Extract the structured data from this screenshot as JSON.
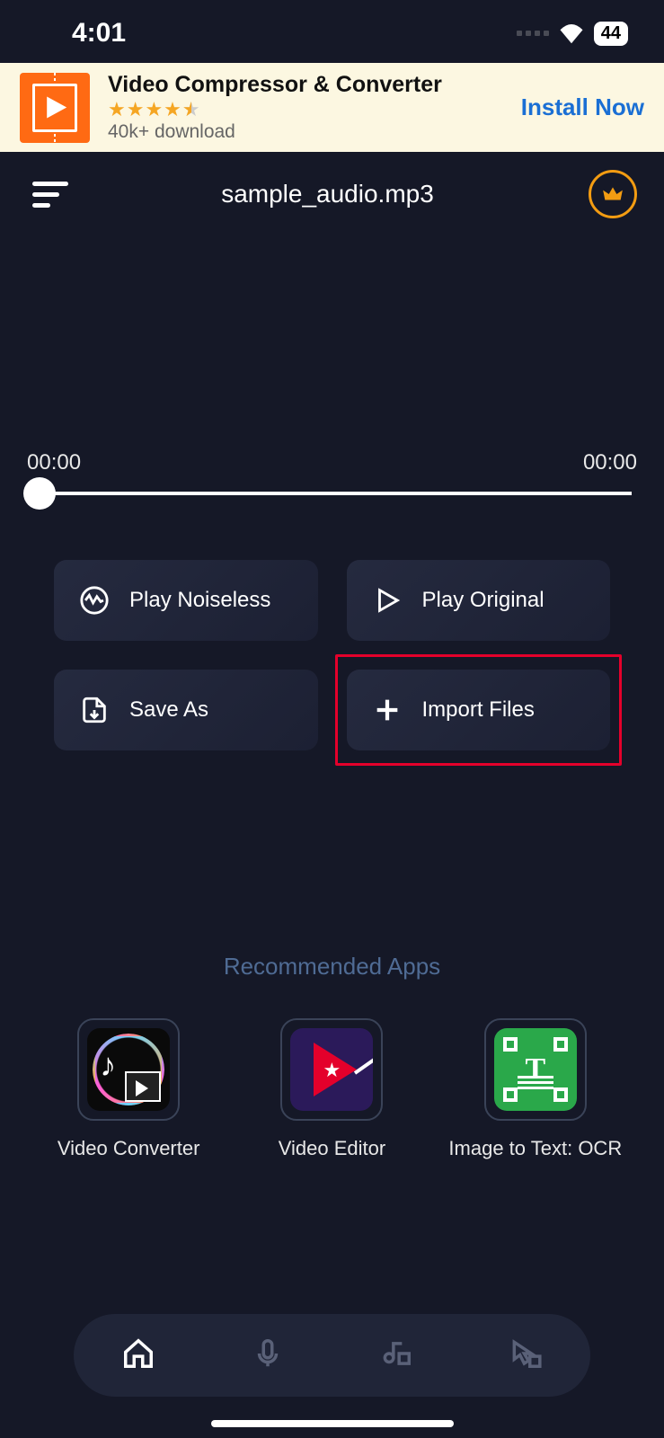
{
  "status": {
    "time": "4:01",
    "battery": "44"
  },
  "ad": {
    "title": "Video Compressor & Converter",
    "downloads": "40k+ download",
    "install": "Install Now"
  },
  "header": {
    "title": "sample_audio.mp3"
  },
  "player": {
    "elapsed": "00:00",
    "total": "00:00"
  },
  "buttons": {
    "play_noiseless": "Play Noiseless",
    "play_original": "Play Original",
    "save_as": "Save As",
    "import_files": "Import Files"
  },
  "recommended": {
    "title": "Recommended Apps",
    "apps": [
      {
        "name": "Video Converter"
      },
      {
        "name": "Video Editor"
      },
      {
        "name": "Image to Text: OCR"
      }
    ]
  }
}
